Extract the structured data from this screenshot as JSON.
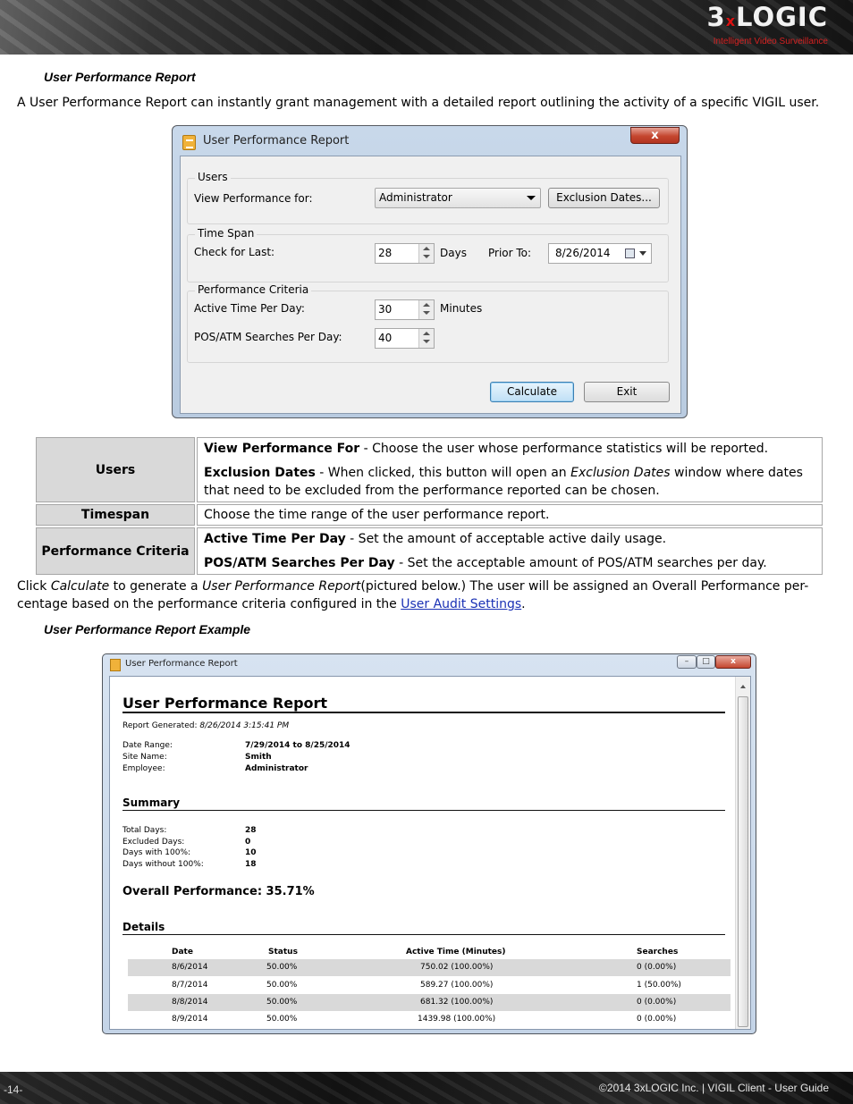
{
  "header": {
    "logo_text": "3xLOGIC",
    "logo_prefix": "3",
    "logo_x": "x",
    "logo_suffix": "LOGIC",
    "logo_tagline": "Intelligent Video Surveillance"
  },
  "section1": {
    "heading": "User Performance Report",
    "intro": "A User Performance Report can instantly grant management with a detailed report outlining the activity of a specific VIGIL user."
  },
  "dialog": {
    "title": "User Performance Report",
    "close_glyph": "x",
    "users_group": "Users",
    "view_perf_label": "View Performance for:",
    "user_value": "Administrator",
    "exclusion_button": "Exclusion Dates...",
    "timespan_group": "Time Span",
    "check_last_label": "Check for Last:",
    "days_value": "28",
    "days_unit": "Days",
    "prior_to_label": "Prior To:",
    "prior_to_value": "8/26/2014",
    "criteria_group": "Performance Criteria",
    "active_time_label": "Active Time Per Day:",
    "active_time_value": "30",
    "active_time_unit": "Minutes",
    "searches_label": "POS/ATM Searches Per Day:",
    "searches_value": "40",
    "calculate_button": "Calculate",
    "exit_button": "Exit"
  },
  "desc_table": {
    "users_head": "Users",
    "view_perf_term": "View Performance For",
    "view_perf_text": " - Choose the user whose performance statistics will be reported.",
    "exclusion_term": "Exclusion Dates",
    "exclusion_text_a": " - When clicked, this button will open an ",
    "exclusion_text_em": "Exclusion Dates",
    "exclusion_text_b": " window where dates that need to be excluded from the performance reported can be chosen.",
    "timespan_head": "Timespan",
    "timespan_text": "Choose the time range of the user performance report.",
    "criteria_head": "Performance Criteria",
    "active_term": "Active Time Per Day",
    "active_text": " - Set the amount of acceptable active daily usage.",
    "searches_term": "POS/ATM Searches Per Day",
    "searches_text": " - Set the acceptable amount of POS/ATM searches per day."
  },
  "para2": {
    "a": "Click ",
    "em1": "Calculate",
    "b": " to generate a ",
    "em2": "User Performance Report",
    "c": "(pictured below.) The user will be assigned an Overall Performance per-",
    "d": "centage based on the performance criteria configured in the ",
    "link": "User Audit Settings",
    "e": "."
  },
  "section2": {
    "heading": "User Performance Report Example"
  },
  "report": {
    "window_title": "User Performance Report",
    "min_glyph": "–",
    "max_glyph": "□",
    "close_glyph": "x",
    "title": "User Performance Report",
    "generated_label": "Report Generated:",
    "generated_value": "8/26/2014 3:15:41 PM",
    "date_range_label": "Date Range:",
    "date_range_value": "7/29/2014 to 8/25/2014",
    "site_label": "Site Name:",
    "site_value": "Smith",
    "employee_label": "Employee:",
    "employee_value": "Administrator",
    "summary_heading": "Summary",
    "total_days_label": "Total Days:",
    "total_days_value": "28",
    "excluded_label": "Excluded Days:",
    "excluded_value": "0",
    "with100_label": "Days with 100%:",
    "with100_value": "10",
    "without100_label": "Days without 100%:",
    "without100_value": "18",
    "overall": "Overall Performance: 35.71%",
    "details_heading": "Details",
    "columns": [
      "Date",
      "Status",
      "Active Time (Minutes)",
      "Searches"
    ],
    "rows": [
      [
        "8/6/2014",
        "50.00%",
        "750.02 (100.00%)",
        "0 (0.00%)"
      ],
      [
        "8/7/2014",
        "50.00%",
        "589.27 (100.00%)",
        "1 (50.00%)"
      ],
      [
        "8/8/2014",
        "50.00%",
        "681.32 (100.00%)",
        "0 (0.00%)"
      ],
      [
        "8/9/2014",
        "50.00%",
        "1439.98 (100.00%)",
        "0 (0.00%)"
      ]
    ]
  },
  "footer": {
    "page": "-14-",
    "copyright": "©2014 3xLOGIC Inc.  |  VIGIL Client - User Guide"
  }
}
